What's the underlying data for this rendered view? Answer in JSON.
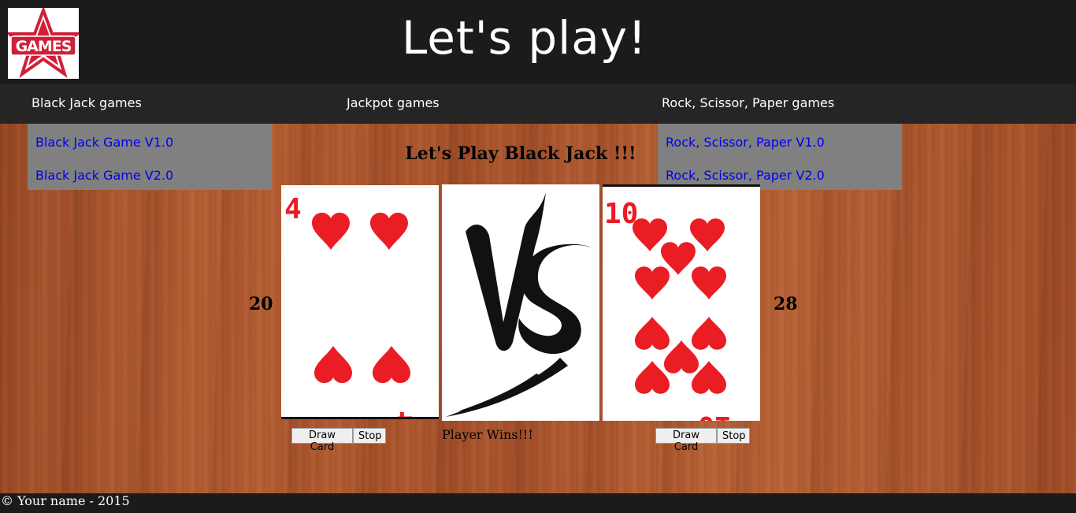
{
  "header": {
    "logo_text": "GAMES",
    "title": "Let's play!"
  },
  "nav": {
    "items": [
      {
        "label": "Black Jack games"
      },
      {
        "label": "Jackpot games"
      },
      {
        "label": "Rock, Scissor, Paper games"
      }
    ]
  },
  "dropdowns": {
    "blackjack": [
      "Black Jack Game V1.0",
      "Black Jack Game V2.0"
    ],
    "rps": [
      "Rock, Scissor, Paper V1.0",
      "Rock, Scissor, Paper V2.0"
    ]
  },
  "game": {
    "heading": "Let's Play Black Jack !!!",
    "player_score": "20",
    "dealer_score": "28",
    "player_card": {
      "rank": "4",
      "suit": "hearts"
    },
    "dealer_card": {
      "rank": "10",
      "suit": "hearts"
    },
    "vs_text": "VS",
    "result": "Player Wins!!!",
    "draw_label": "Draw Card",
    "stop_label": "Stop"
  },
  "footer": {
    "text": "© Your name - 2015"
  },
  "colors": {
    "header_bg": "#1b1b1b",
    "nav_bg": "#252525",
    "dropdown_bg": "#808080",
    "link": "#0000ee",
    "heart_red": "#ea1c24"
  }
}
